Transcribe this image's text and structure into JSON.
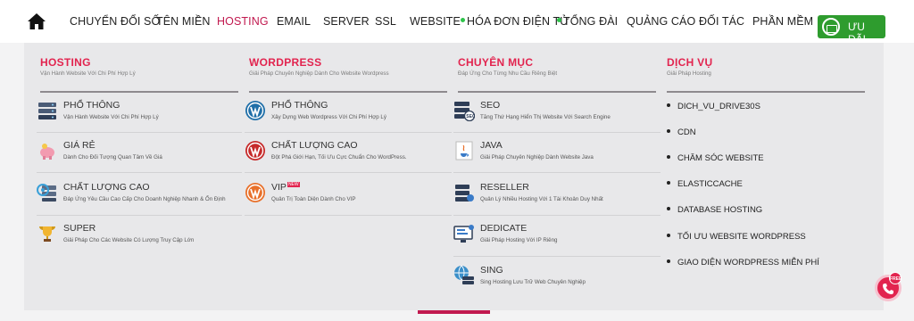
{
  "nav": {
    "home_icon": "home-icon",
    "items": [
      {
        "label": "CHUYỂN ĐỔI SỐ"
      },
      {
        "label": "TÊN MIỀN"
      },
      {
        "label": "HOSTING"
      },
      {
        "label": "EMAIL"
      },
      {
        "label": "SERVER"
      },
      {
        "label": "SSL"
      },
      {
        "label": "WEBSITE"
      },
      {
        "label": "HÓA ĐƠN ĐIỆN TỬ"
      },
      {
        "label": "TỔNG ĐÀI"
      },
      {
        "label": "QUẢNG CÁO"
      },
      {
        "label": "ĐỐI TÁC"
      },
      {
        "label": "PHẦN MỀM"
      }
    ],
    "promo_label": "ƯU ĐÃI",
    "active_color": "#c1194f",
    "promo_color": "#2e9c2e"
  },
  "columns": [
    {
      "title": "HOSTING",
      "subtitle": "Vận Hành Website Với Chi Phí Hợp Lý",
      "items": [
        {
          "name": "PHỔ THÔNG",
          "desc": "Vận Hành Website Với Chi Phí Hợp Lý",
          "icon": "server-rack-icon"
        },
        {
          "name": "GIÁ RẺ",
          "desc": "Dành Cho Đối Tượng Quan Tâm Về Giá",
          "icon": "piggy-bank-icon"
        },
        {
          "name": "CHẤT LƯỢNG CAO",
          "desc": "Đáp Ứng Yêu Cầu Cao Cấp Cho Doanh Nghiệp Nhanh & Ổn Định",
          "icon": "server-gear-icon"
        },
        {
          "name": "SUPER",
          "desc": "Giải Pháp Cho Các Website Có Lượng Truy Cập Lớn",
          "icon": "trophy-icon"
        }
      ]
    },
    {
      "title": "WORDPRESS",
      "subtitle": "Giải Pháp Chuyên Nghiệp Dành Cho Website Wordpress",
      "items": [
        {
          "name": "PHỔ THÔNG",
          "desc": "Xây Dựng Web Wordpress Với Chi Phí Hợp Lý",
          "icon": "wordpress-blue-icon"
        },
        {
          "name": "CHẤT LƯỢNG CAO",
          "desc": "Đột Phá Giới Hạn, Tối Ưu Cực Chuẩn Cho WordPress.",
          "icon": "wordpress-red-icon"
        },
        {
          "name": "VIP",
          "badge": "NEW",
          "desc": "Quản Trị Toàn Diện Dành Cho VIP",
          "icon": "wordpress-orange-icon"
        }
      ]
    },
    {
      "title": "CHUYÊN MỤC",
      "subtitle": "Đáp Ứng Cho Từng Nhu Cầu Riêng Biệt",
      "items": [
        {
          "name": "SEO",
          "desc": "Tăng Thứ Hạng Hiển Thị Website Với Search Engine",
          "icon": "seo-server-icon"
        },
        {
          "name": "JAVA",
          "desc": "Giải Pháp Chuyên Nghiệp Dành Website Java",
          "icon": "java-icon"
        },
        {
          "name": "RESELLER",
          "desc": "Quản Lý Nhiều Hosting Với 1 Tài Khoản Duy Nhất",
          "icon": "reseller-server-icon"
        },
        {
          "name": "DEDICATE",
          "desc": "Giải Pháp Hosting Với IP Riêng",
          "icon": "dedicated-monitor-icon"
        },
        {
          "name": "SING",
          "desc": "Sing Hosting Lưu Trữ Web Chuyên Nghiệp",
          "icon": "globe-server-icon"
        }
      ]
    },
    {
      "title": "DỊCH VỤ",
      "subtitle": "Giải Pháp Hosting",
      "services": [
        "DICH_VU_DRIVE30S",
        "CDN",
        "CHĂM SÓC WEBSITE",
        "ELASTICCACHE",
        "DATABASE HOSTING",
        "TỐI ƯU WEBSITE WORDPRESS",
        "GIAO DIỆN WORDPRESS MIỄN PHÍ"
      ]
    }
  ],
  "free_call_badge": "FREE"
}
